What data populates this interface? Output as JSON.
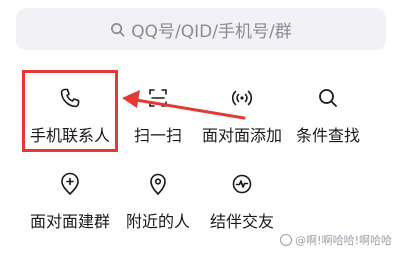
{
  "search": {
    "placeholder": "QQ号/QID/手机号/群",
    "icon": "search-icon"
  },
  "menu": {
    "row1": [
      {
        "label": "手机联系人",
        "icon": "phone-icon"
      },
      {
        "label": "扫一扫",
        "icon": "scan-icon"
      },
      {
        "label": "面对面添加",
        "icon": "broadcast-icon"
      },
      {
        "label": "条件查找",
        "icon": "search-icon"
      }
    ],
    "row2": [
      {
        "label": "面对面建群",
        "icon": "location-group-icon"
      },
      {
        "label": "附近的人",
        "icon": "location-pin-icon"
      },
      {
        "label": "结伴交友",
        "icon": "activity-icon"
      }
    ]
  },
  "annotation": {
    "highlight_color": "#e53935"
  },
  "watermark": {
    "text": "@啊!啊哈哈!啊哈哈"
  }
}
